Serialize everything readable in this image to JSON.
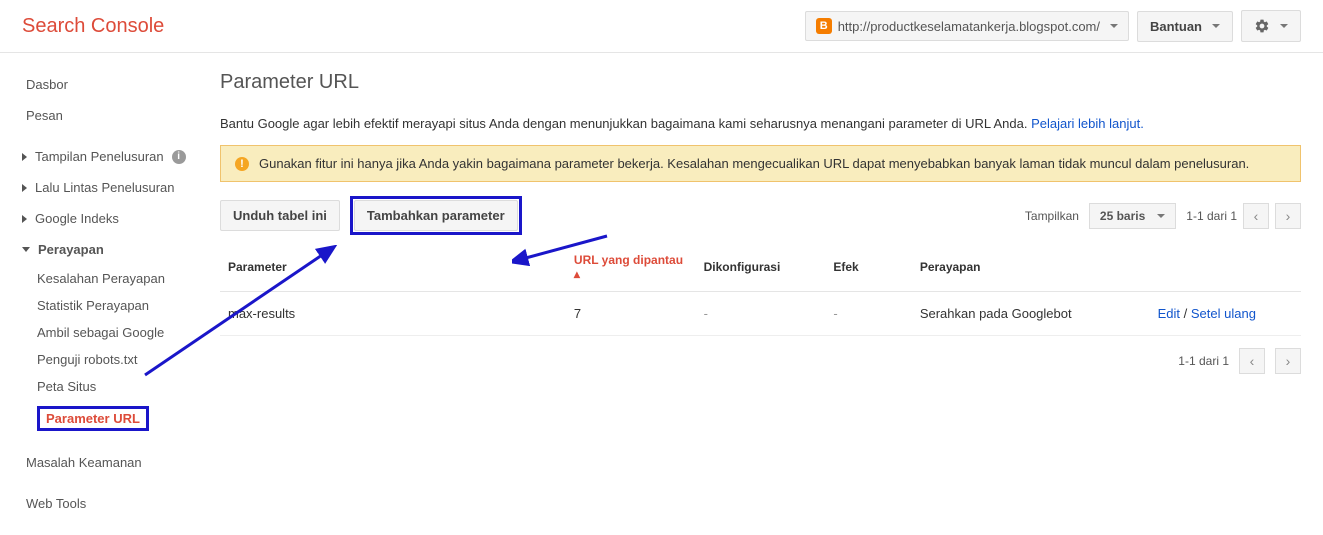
{
  "header": {
    "title": "Search Console",
    "site_url": "http://productkeselamatankerja.blogspot.com/",
    "help_label": "Bantuan"
  },
  "sidebar": {
    "dasbor": "Dasbor",
    "pesan": "Pesan",
    "tampilan": "Tampilan Penelusuran",
    "lalu_lintas": "Lalu Lintas Penelusuran",
    "google_indeks": "Google Indeks",
    "perayapan": "Perayapan",
    "sub": {
      "kesalahan": "Kesalahan Perayapan",
      "statistik": "Statistik Perayapan",
      "ambil": "Ambil sebagai Google",
      "penguji": "Penguji robots.txt",
      "peta": "Peta Situs",
      "parameter": "Parameter URL"
    },
    "masalah": "Masalah Keamanan",
    "webtools": "Web Tools"
  },
  "main": {
    "title": "Parameter URL",
    "intro_text": "Bantu Google agar lebih efektif merayapi situs Anda dengan menunjukkan bagaimana kami seharusnya menangani parameter di URL Anda. ",
    "intro_link": "Pelajari lebih lanjut.",
    "warning_text": "Gunakan fitur ini hanya jika Anda yakin bagaimana parameter bekerja. Kesalahan mengecualikan URL dapat menyebabkan banyak laman tidak muncul dalam penelusuran.",
    "btn_download": "Unduh tabel ini",
    "btn_add": "Tambahkan parameter",
    "show_label": "Tampilkan",
    "rows_label": "25 baris",
    "pager_text": "1-1 dari 1",
    "columns": {
      "parameter": "Parameter",
      "url": "URL yang dipantau",
      "dikonfigurasi": "Dikonfigurasi",
      "efek": "Efek",
      "perayapan": "Perayapan"
    },
    "sort_indicator": "▴",
    "rows": [
      {
        "parameter": "max-results",
        "url": "7",
        "dikonfigurasi": "-",
        "efek": "-",
        "perayapan": "Serahkan pada Googlebot",
        "edit": "Edit",
        "reset": "Setel ulang"
      }
    ]
  }
}
